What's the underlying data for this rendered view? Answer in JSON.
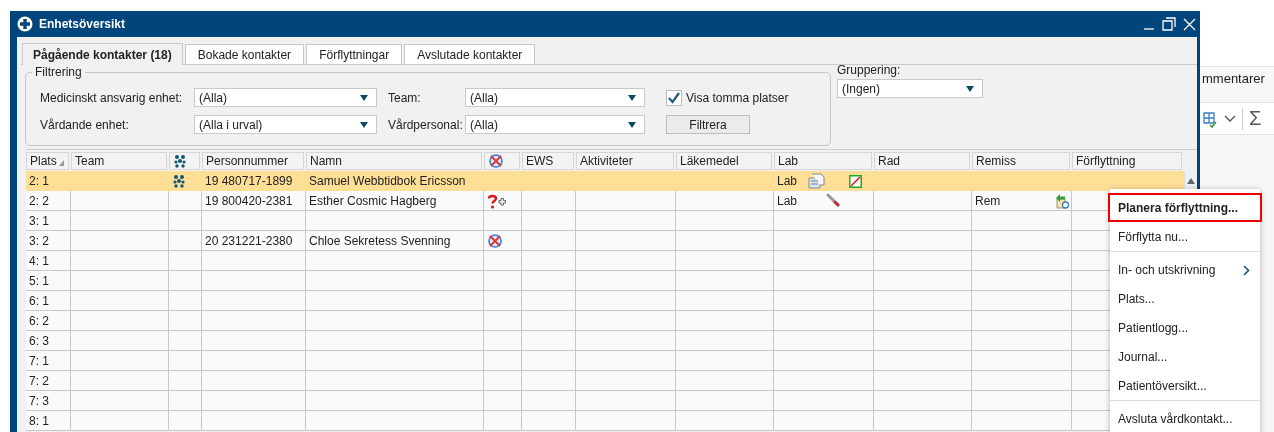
{
  "window": {
    "title": "Enhetsöversikt"
  },
  "tabs": [
    {
      "label": "Pågående kontakter (18)",
      "selected": true
    },
    {
      "label": "Bokade kontakter",
      "selected": false
    },
    {
      "label": "Förflyttningar",
      "selected": false
    },
    {
      "label": "Avslutade kontakter",
      "selected": false
    }
  ],
  "filter": {
    "legend": "Filtrering",
    "fields": [
      {
        "label": "Medicinskt ansvarig enhet:",
        "value": "(Alla)"
      },
      {
        "label": "Team:",
        "value": "(Alla)"
      },
      {
        "label": "Vårdande enhet:",
        "value": "(Alla i urval)"
      },
      {
        "label": "Vårdpersonal:",
        "value": "(Alla)"
      }
    ],
    "checkbox": {
      "label": "Visa tomma platser",
      "checked": true
    },
    "button": "Filtrera"
  },
  "grouping": {
    "label": "Gruppering:",
    "value": "(Ingen)"
  },
  "table": {
    "columns": [
      {
        "kind": "sorted",
        "label": "Plats"
      },
      {
        "kind": "text",
        "label": "Team"
      },
      {
        "kind": "dots"
      },
      {
        "kind": "text",
        "label": "Personnummer"
      },
      {
        "kind": "text",
        "label": "Namn"
      },
      {
        "kind": "crossed"
      },
      {
        "kind": "text",
        "label": "EWS"
      },
      {
        "kind": "text",
        "label": "Aktiviteter"
      },
      {
        "kind": "text",
        "label": "Läkemedel"
      },
      {
        "kind": "text",
        "label": "Lab"
      },
      {
        "kind": "text",
        "label": "Rad"
      },
      {
        "kind": "text",
        "label": "Remiss"
      },
      {
        "kind": "text",
        "label": "Förflyttning"
      }
    ],
    "rows": [
      {
        "selected": true,
        "plats": "2: 1",
        "flag_icon": {
          "kind": "dots"
        },
        "personnummer": "19 480717-1899",
        "namn": "Samuel Webbtidbok Ericsson",
        "lab": "Lab",
        "lab_icons": [
          {
            "kind": "document"
          },
          {
            "kind": "slashed"
          }
        ]
      },
      {
        "selected": false,
        "plats": "2: 2",
        "personnummer": "19 800420-2381",
        "namn": "Esther Cosmic Hagberg",
        "status_icon": {
          "kind": "question"
        },
        "lab": "Lab",
        "lab_icons": [
          {
            "kind": "tube"
          }
        ],
        "remiss": "Rem",
        "remiss_icon": {
          "kind": "arrow"
        }
      },
      {
        "selected": false,
        "plats": "3: 1"
      },
      {
        "selected": false,
        "plats": "3: 2",
        "personnummer": "20 231221-2380",
        "namn": "Chloe Sekretess Svenning",
        "status_icon": {
          "kind": "crossed"
        }
      },
      {
        "selected": false,
        "plats": "4: 1"
      },
      {
        "selected": false,
        "plats": "5: 1"
      },
      {
        "selected": false,
        "plats": "6: 1"
      },
      {
        "selected": false,
        "plats": "6: 2"
      },
      {
        "selected": false,
        "plats": "6: 3"
      },
      {
        "selected": false,
        "plats": "7: 1"
      },
      {
        "selected": false,
        "plats": "7: 2"
      },
      {
        "selected": false,
        "plats": "7: 3"
      },
      {
        "selected": false,
        "plats": "8: 1"
      }
    ]
  },
  "context_menu": [
    {
      "label": "Planera förflyttning...",
      "highlighted": true,
      "submenu": false,
      "separator_before": false
    },
    {
      "label": "Förflytta nu...",
      "highlighted": false,
      "submenu": false,
      "separator_before": false
    },
    {
      "label": "In- och utskrivning",
      "highlighted": false,
      "submenu": true,
      "separator_before": true
    },
    {
      "label": "Plats...",
      "highlighted": false,
      "submenu": false,
      "separator_before": false
    },
    {
      "label": "Patientlogg...",
      "highlighted": false,
      "submenu": false,
      "separator_before": false
    },
    {
      "label": "Journal...",
      "highlighted": false,
      "submenu": false,
      "separator_before": false
    },
    {
      "label": "Patientöversikt...",
      "highlighted": false,
      "submenu": false,
      "separator_before": false
    },
    {
      "label": "Avsluta vårdkontakt...",
      "highlighted": false,
      "submenu": false,
      "separator_before": true
    }
  ],
  "background_app": {
    "tab_label": "mmentarer",
    "sum_symbol": "Σ"
  }
}
